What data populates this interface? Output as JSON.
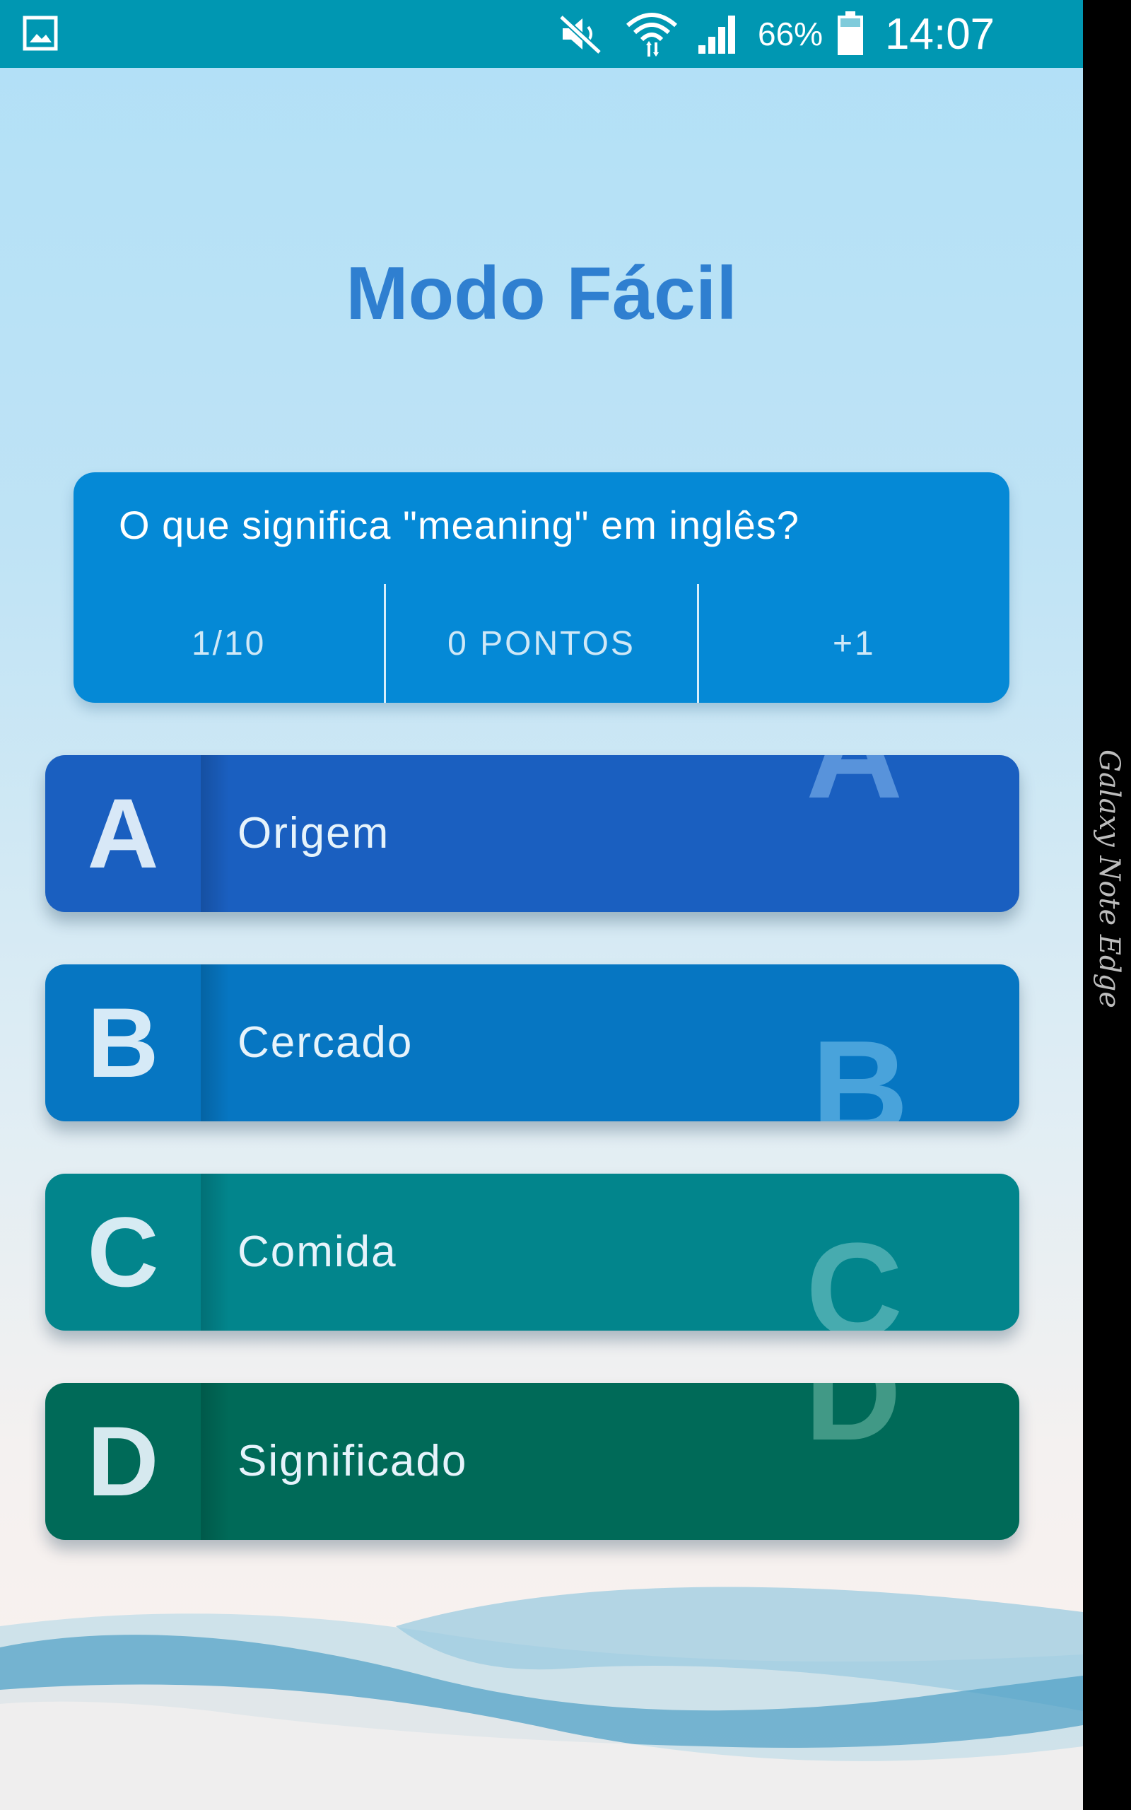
{
  "status_bar": {
    "battery_percent": "66%",
    "clock": "14:07",
    "icons": [
      "gallery-icon",
      "mute-icon",
      "wifi-icon",
      "signal-icon",
      "battery-icon"
    ]
  },
  "edge_panel": {
    "label": "Galaxy Note Edge"
  },
  "title": "Modo Fácil",
  "question": {
    "text": "O que significa \"meaning\" em inglês?",
    "progress": "1/10",
    "score": "0 PONTOS",
    "bonus": "+1"
  },
  "answers": [
    {
      "letter": "A",
      "text": "Origem",
      "color": "#1a5fc0"
    },
    {
      "letter": "B",
      "text": "Cercado",
      "color": "#0676c2"
    },
    {
      "letter": "C",
      "text": "Comida",
      "color": "#02858c"
    },
    {
      "letter": "D",
      "text": "Significado",
      "color": "#006a58"
    }
  ],
  "colors": {
    "status_bar": "#0097b2",
    "title": "#2f7fd0",
    "question_card": "#0589d6"
  }
}
